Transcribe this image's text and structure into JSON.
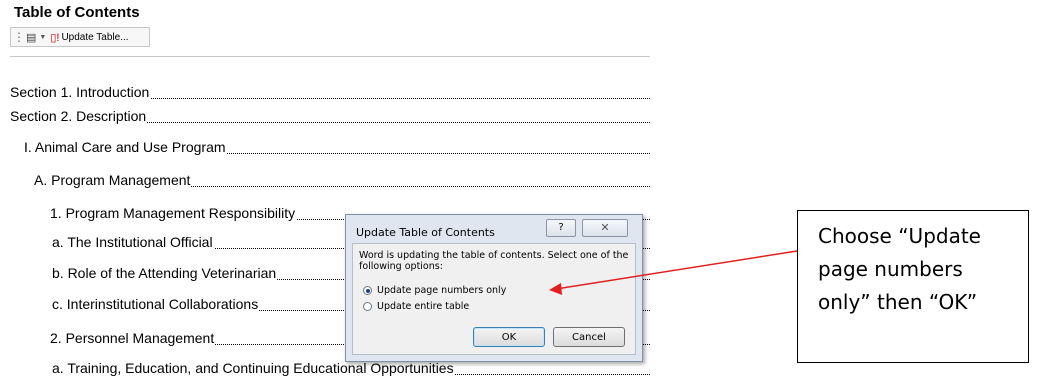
{
  "heading": "Table of Contents",
  "toolbar": {
    "menu_icon": "document-icon",
    "update_icon": "update-table-icon",
    "update_label": "Update Table..."
  },
  "toc": [
    {
      "label": "Section 1.  Introduction",
      "level": 0
    },
    {
      "label": "Section 2.  Description",
      "level": 0
    },
    {
      "label": "I.   Animal Care and Use Program",
      "level": 1
    },
    {
      "label": "A.  Program Management",
      "level": 2
    },
    {
      "label": "1.  Program Management Responsibility",
      "level": 3
    },
    {
      "label": "a.  The Institutional Official",
      "level": 4
    },
    {
      "label": "b.  Role of the Attending Veterinarian",
      "level": 4
    },
    {
      "label": "c.  Interinstitutional Collaborations",
      "level": 4
    },
    {
      "label": "2.  Personnel Management",
      "level": 3
    },
    {
      "label": "a.  Training, Education, and Continuing Educational Opportunities",
      "level": 4
    }
  ],
  "dialog": {
    "title": "Update Table of Contents",
    "help": "?",
    "close": "✕",
    "message": "Word is updating the table of contents.  Select one of the following options:",
    "option1": "Update page numbers only",
    "option2": "Update entire table",
    "selected": "option1",
    "ok": "OK",
    "cancel": "Cancel"
  },
  "callout": {
    "line1": "Choose “Update",
    "line2": "page numbers",
    "line3": "only” then “OK”",
    "arrow_color": "#e02020"
  }
}
